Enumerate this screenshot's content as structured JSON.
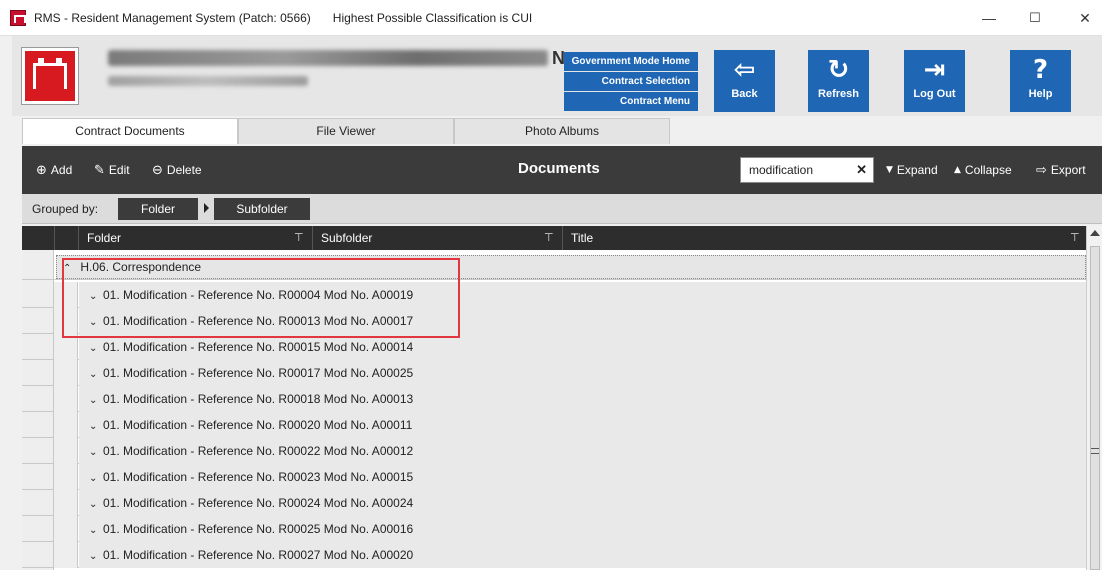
{
  "window": {
    "title": "RMS - Resident Management System (Patch: 0566)",
    "classification": "Highest Possible Classification is CUI",
    "controls": {
      "minimize": "—",
      "maximize": "☐",
      "close": "✕"
    }
  },
  "header": {
    "site_suffix": "N",
    "nav_links": [
      "Government Mode Home",
      "Contract Selection",
      "Contract Menu"
    ],
    "buttons": [
      {
        "label": "Back",
        "icon": "⇦"
      },
      {
        "label": "Refresh",
        "icon": "↻"
      },
      {
        "label": "Log Out",
        "icon": "⇥"
      },
      {
        "label": "Help",
        "icon": "?"
      }
    ],
    "accent_color": "#1f66b5",
    "logo_color": "#d71920"
  },
  "tabs": [
    "Contract Documents",
    "File Viewer",
    "Photo Albums"
  ],
  "toolbar": {
    "add_label": "Add",
    "edit_label": "Edit",
    "delete_label": "Delete",
    "title": "Documents",
    "search_value": "modification",
    "search_clear": "✕",
    "expand_label": "Expand",
    "collapse_label": "Collapse",
    "export_label": "Export"
  },
  "grouped_by": {
    "label": "Grouped by:",
    "chips": [
      "Folder",
      "Subfolder"
    ]
  },
  "grid": {
    "columns": [
      "Folder",
      "Subfolder",
      "Title"
    ],
    "group_row": "H.06. Correspondence",
    "rows": [
      "01. Modification - Reference No. R00004 Mod No. A00019",
      "01. Modification - Reference No. R00013 Mod No. A00017",
      "01. Modification - Reference No. R00015 Mod No. A00014",
      "01. Modification - Reference No. R00017 Mod No. A00025",
      "01. Modification - Reference No. R00018 Mod No. A00013",
      "01. Modification - Reference No. R00020 Mod No. A00011",
      "01. Modification - Reference No. R00022 Mod No. A00012",
      "01. Modification - Reference No. R00023 Mod No. A00015",
      "01. Modification - Reference No. R00024 Mod No. A00024",
      "01. Modification - Reference No. R00025 Mod No. A00016",
      "01. Modification - Reference No. R00027 Mod No. A00020"
    ]
  },
  "highlight_color": "#e0383e"
}
